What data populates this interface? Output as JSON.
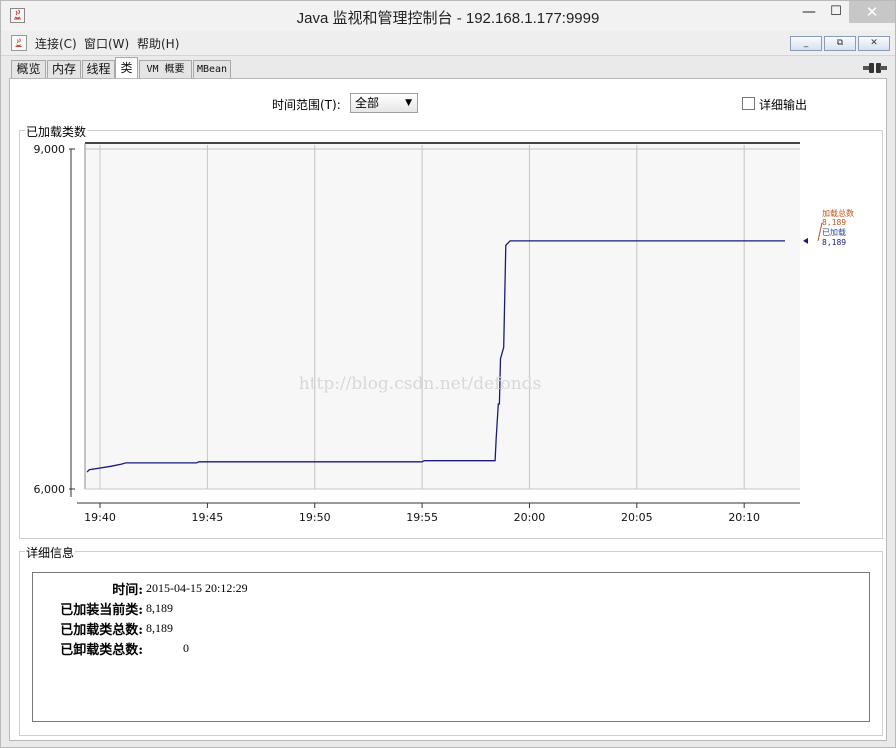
{
  "window": {
    "title": "Java 监视和管理控制台 - 192.168.1.177:9999"
  },
  "titlebar": {
    "minimize": "—",
    "maximize": "☐",
    "close": "✕"
  },
  "menu": {
    "items": [
      "连接(C)",
      "窗口(W)",
      "帮助(H)"
    ],
    "mdi_buttons": [
      "_",
      "⧉",
      "✕"
    ]
  },
  "tabs": [
    "概览",
    "内存",
    "线程",
    "类",
    "VM 概要",
    "MBean"
  ],
  "controls": {
    "range_label": "时间范围(T):",
    "range_value": "全部",
    "detail_output_label": "详细输出",
    "detail_output_checked": false
  },
  "chart_panel": {
    "title": "已加载类数"
  },
  "chart_data": {
    "type": "line",
    "ylim": [
      6000,
      9000
    ],
    "y_ticks": [
      "9,000",
      "6,000"
    ],
    "y_tick_values": [
      9000,
      6000
    ],
    "x_ticks": [
      "19:40",
      "19:45",
      "19:50",
      "19:55",
      "20:00",
      "20:05",
      "20:10"
    ],
    "x_tick_minutes": [
      0,
      5,
      10,
      15,
      20,
      25,
      30
    ],
    "xlim_minutes": [
      -0.7,
      32.6
    ],
    "series": [
      {
        "name": "已加载",
        "color": "#1a1a7a",
        "points": [
          [
            -0.6,
            6150
          ],
          [
            -0.5,
            6170
          ],
          [
            0.5,
            6200
          ],
          [
            1.0,
            6220
          ],
          [
            1.2,
            6230
          ],
          [
            4.5,
            6230
          ],
          [
            4.6,
            6240
          ],
          [
            15.0,
            6240
          ],
          [
            15.1,
            6250
          ],
          [
            18.4,
            6250
          ],
          [
            18.45,
            6450
          ],
          [
            18.55,
            6750
          ],
          [
            18.6,
            6750
          ],
          [
            18.65,
            7150
          ],
          [
            18.8,
            7250
          ],
          [
            18.9,
            8150
          ],
          [
            19.1,
            8189
          ],
          [
            31.9,
            8189
          ]
        ]
      }
    ],
    "legend": {
      "position": "right",
      "entries": [
        {
          "label": "加载总数",
          "value": "8,189",
          "color": "#c0541c"
        },
        {
          "label": "已加载",
          "value": "8,189",
          "color": "#2a4a9a"
        }
      ]
    },
    "grid": true
  },
  "info_panel": {
    "title": "详细信息",
    "rows": [
      {
        "label": "时间:",
        "value": "2015-04-15 20:12:29"
      },
      {
        "label": "已加装当前类:",
        "value": "8,189"
      },
      {
        "label": "已加载类总数:",
        "value": "8,189"
      },
      {
        "label": "已卸载类总数:",
        "value": "0"
      }
    ]
  },
  "watermark": "http://blog.csdn.net/defonds"
}
